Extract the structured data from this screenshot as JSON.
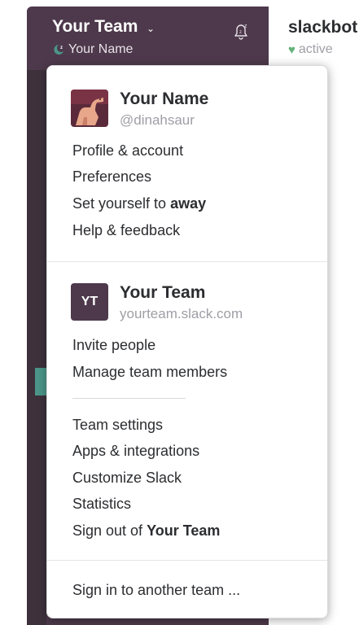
{
  "sidebar": {
    "team_name": "Your Team",
    "user_name": "Your Name"
  },
  "channel": {
    "name": "slackbot",
    "presence": "active"
  },
  "menu": {
    "user": {
      "name": "Your Name",
      "handle": "@dinahsaur",
      "items": [
        {
          "label": "Profile & account"
        },
        {
          "label": "Preferences"
        },
        {
          "prefix": "Set yourself to ",
          "bold": "away"
        },
        {
          "label": "Help & feedback"
        }
      ]
    },
    "team": {
      "initials": "YT",
      "name": "Your Team",
      "domain": "yourteam.slack.com",
      "items_primary": [
        {
          "label": "Invite people"
        },
        {
          "label": "Manage team members"
        }
      ],
      "items_secondary": [
        {
          "label": "Team settings"
        },
        {
          "label": "Apps & integrations"
        },
        {
          "label": "Customize Slack"
        },
        {
          "label": "Statistics"
        },
        {
          "prefix": "Sign out of ",
          "bold": "Your Team"
        }
      ]
    },
    "sign_in": "Sign in to another team ..."
  },
  "colors": {
    "sidebar": "#4d394b",
    "accent_teal": "#4c9689",
    "presence_green": "#66b27b"
  },
  "icons": {
    "team_menu_toggle": "chevron-down-icon",
    "user_status": "moon-icon",
    "notifications": "bell-snooze-icon",
    "presence": "heart-icon"
  }
}
